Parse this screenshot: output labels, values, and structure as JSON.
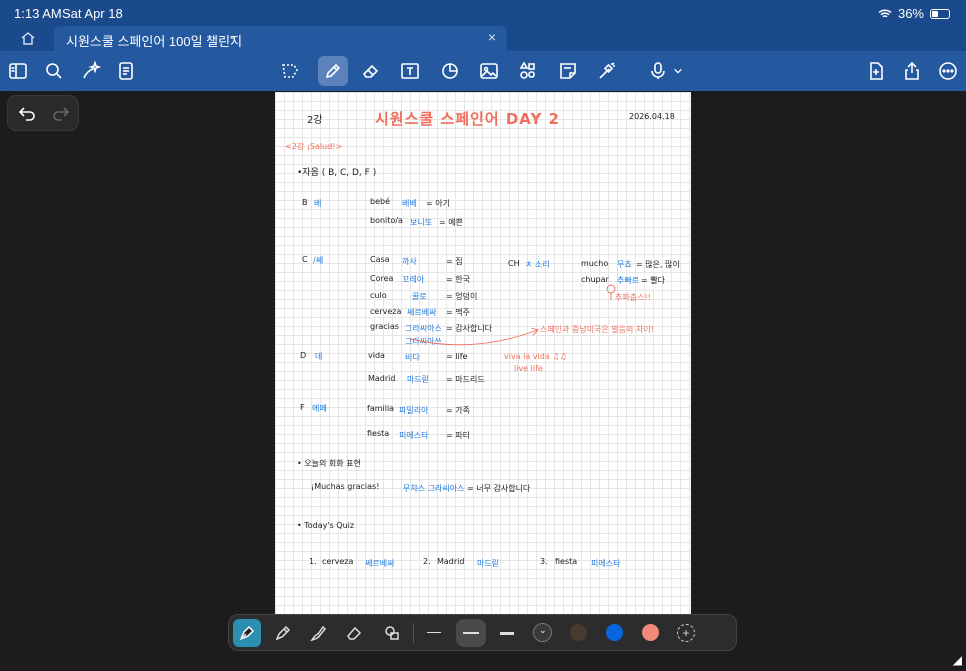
{
  "status": {
    "time": "1:13 AM",
    "date": "Sat Apr 18",
    "battery": "36%",
    "battery_level": 0.36
  },
  "tab": {
    "title": "시원스쿨 스페인어 100일 챌린지",
    "chevron": "⌄",
    "close": "×"
  },
  "toolbar": {
    "left_icons": [
      "sidebar-icon",
      "search-icon",
      "ai-sparkle-icon",
      "document-icon"
    ],
    "center_icons": [
      "lasso-icon",
      "pen-icon",
      "eraser-icon",
      "text-box-icon",
      "shapes-icon",
      "image-icon",
      "elements-icon",
      "sticky-note-icon",
      "laser-icon",
      "mic-icon"
    ],
    "right_icons": [
      "add-page-icon",
      "share-icon",
      "more-icon"
    ]
  },
  "note": {
    "lecture": "2강",
    "title": "시원스쿨 스페인어 DAY 2",
    "date": "2026.04.18",
    "subtitle": "<2강 ¡Salud!>",
    "consonants_header": "•자음 ( B, C, D, F )",
    "b": {
      "letter": "B",
      "name": "베",
      "words": [
        {
          "es": "bebé",
          "pron": "베베",
          "ko": "= 아기"
        },
        {
          "es": "bonito/a",
          "pron": "보니또",
          "ko": "= 예쁜"
        }
      ]
    },
    "c": {
      "letter": "C",
      "name": "/쎄",
      "words": [
        {
          "es": "Casa",
          "pron": "까사",
          "ko": "= 집"
        },
        {
          "es": "Corea",
          "pron": "꼬레아",
          "ko": "= 한국"
        },
        {
          "es": "culo",
          "pron": "꿀로",
          "ko": "= 엉덩이"
        },
        {
          "es": "cerveza",
          "pron": "쎄르베싸",
          "ko": "= 맥주"
        },
        {
          "es": "gracias",
          "pron": "그라씨아스",
          "pron2": "그라씨아쓰",
          "ko": "= 감사합니다"
        }
      ]
    },
    "ch": {
      "label": "CH",
      "sound": "ㅊ 소리",
      "words": [
        {
          "es": "mucho",
          "pron": "무쵸",
          "ko": "= 많은, 많이"
        },
        {
          "es": "chupar",
          "pron": "추빠르",
          "ko": "= 빨다"
        }
      ],
      "example": "추파춥스!!"
    },
    "note_arrow": "스페인과 중남미국은 발음의 차이!",
    "d": {
      "letter": "D",
      "name": "데",
      "words": [
        {
          "es": "vida",
          "pron": "비다",
          "ko": "= life"
        },
        {
          "es": "Madrid",
          "pron": "마드릳",
          "ko": "= 마드리드"
        }
      ],
      "song": "viva la vida ♫♫",
      "song_trans": "live life"
    },
    "f": {
      "letter": "F",
      "name": "에페",
      "words": [
        {
          "es": "familia",
          "pron": "파밀리아",
          "ko": "= 가족"
        },
        {
          "es": "fiesta",
          "pron": "피에스타",
          "ko": "= 파티"
        }
      ]
    },
    "expr_header": "• 오늘의 회화 표현",
    "expr": {
      "es": "¡Muchas gracias!",
      "pron": "무챠스 그라씨아스",
      "ko": "= 너무 감사합니다"
    },
    "quiz_header": "• Today's Quiz",
    "quiz": [
      {
        "n": "1.",
        "es": "cerveza",
        "pron": "쎄르베싸"
      },
      {
        "n": "2.",
        "es": "Madrid",
        "pron": "마드릳"
      },
      {
        "n": "3.",
        "es": "fiesta",
        "pron": "피에스타"
      }
    ]
  },
  "penbar": {
    "tools": [
      "fountain-pen-icon",
      "ball-pen-icon",
      "brush-pen-icon",
      "eraser-icon",
      "shape-tool-icon"
    ],
    "colors": [
      "#3a3a3a",
      "#4a3a2e",
      "#0a66e0",
      "#f08a7a"
    ],
    "add_label": "+"
  }
}
